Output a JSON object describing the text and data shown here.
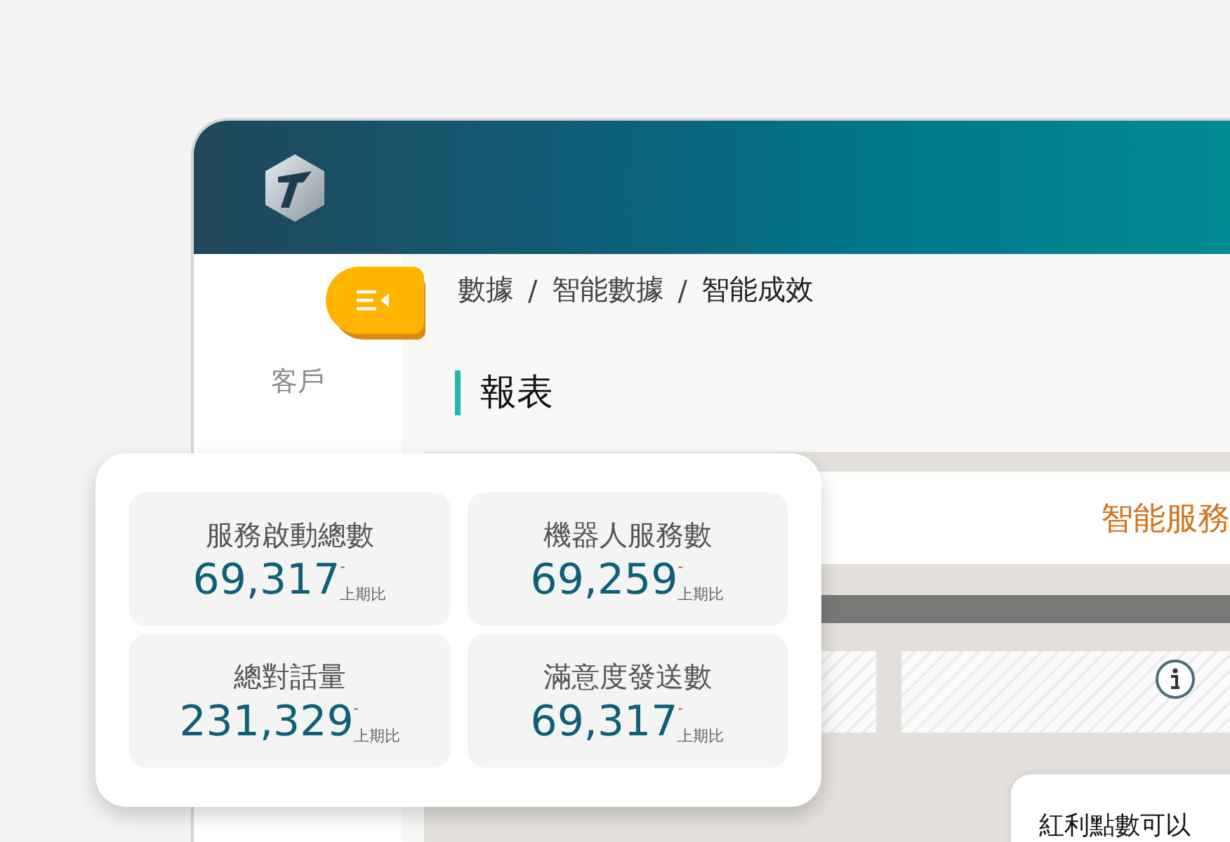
{
  "sidebar": {
    "items": [
      {
        "label": "客戶"
      }
    ]
  },
  "breadcrumb": [
    "數據",
    "智能數據",
    "智能成效"
  ],
  "breadcrumb_separator": "/",
  "page_title": "報表",
  "report": {
    "banner_title": "智能服務",
    "tooltip": "紅利點數可以"
  },
  "stats": [
    {
      "label": "服務啟動總數",
      "value": "69,317",
      "trend": "-",
      "compare": "上期比"
    },
    {
      "label": "機器人服務數",
      "value": "69,259",
      "trend": "-",
      "compare": "上期比"
    },
    {
      "label": "總對話量",
      "value": "231,329",
      "trend": "-",
      "compare": "上期比"
    },
    {
      "label": "滿意度發送數",
      "value": "69,317",
      "trend": "-",
      "compare": "上期比"
    }
  ]
}
